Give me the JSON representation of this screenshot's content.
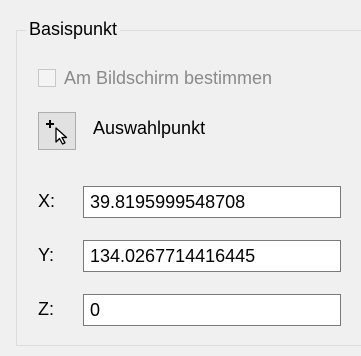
{
  "group": {
    "title": "Basispunkt"
  },
  "screen_pick": {
    "label": "Am Bildschirm bestimmen",
    "checked": false,
    "enabled": false
  },
  "pick_point": {
    "icon": "cursor-plus-icon",
    "label": "Auswahlpunkt"
  },
  "coordinates": {
    "x": {
      "label": "X:",
      "value": "39.8195999548708"
    },
    "y": {
      "label": "Y:",
      "value": "134.0267714416445"
    },
    "z": {
      "label": "Z:",
      "value": "0"
    }
  }
}
